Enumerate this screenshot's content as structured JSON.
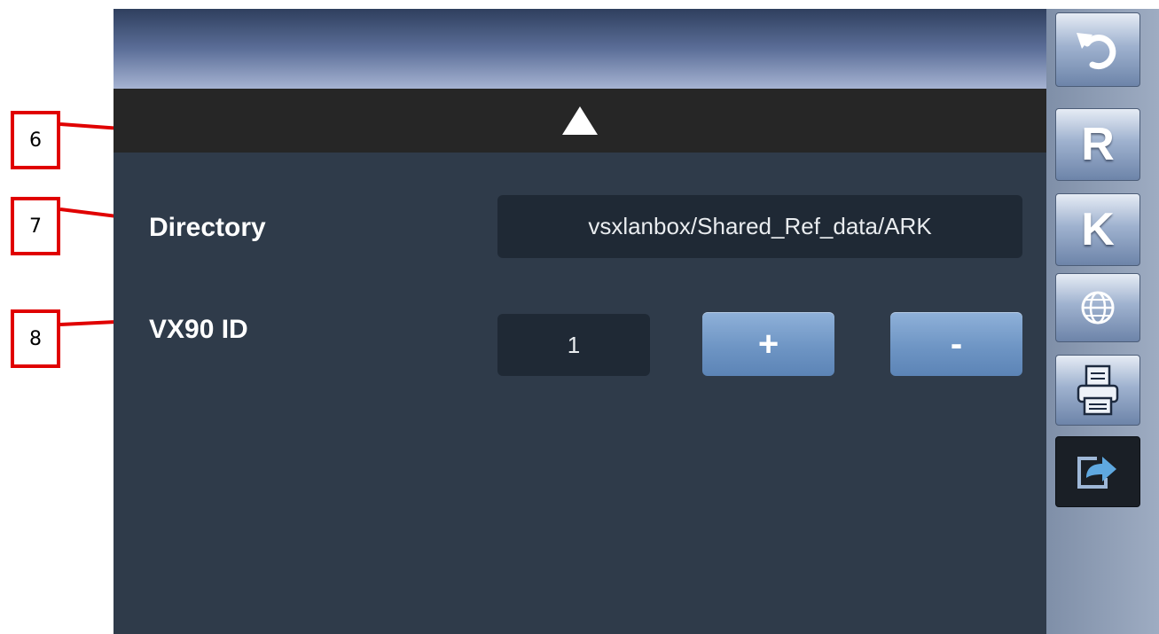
{
  "callouts": [
    "6",
    "7",
    "8"
  ],
  "collapse_bar": {
    "icon": "triangle-up-icon"
  },
  "settings": {
    "directory": {
      "label": "Directory",
      "value": "vsxlanbox/Shared_Ref_data/ARK"
    },
    "vx90_id": {
      "label": "VX90 ID",
      "value": "1",
      "increment_label": "+",
      "decrement_label": "-"
    }
  },
  "toolbar": {
    "undo_icon": "undo-arrow-icon",
    "r_label": "R",
    "k_label": "K",
    "globe_icon": "globe-icon",
    "printer_icon": "printer-icon",
    "export_icon": "export-icon"
  },
  "colors": {
    "background": "#2f3b4a",
    "collapse_bar": "#262626",
    "field": "#1f2935",
    "button_accent": "#6e95c4",
    "callout": "#e00000"
  }
}
